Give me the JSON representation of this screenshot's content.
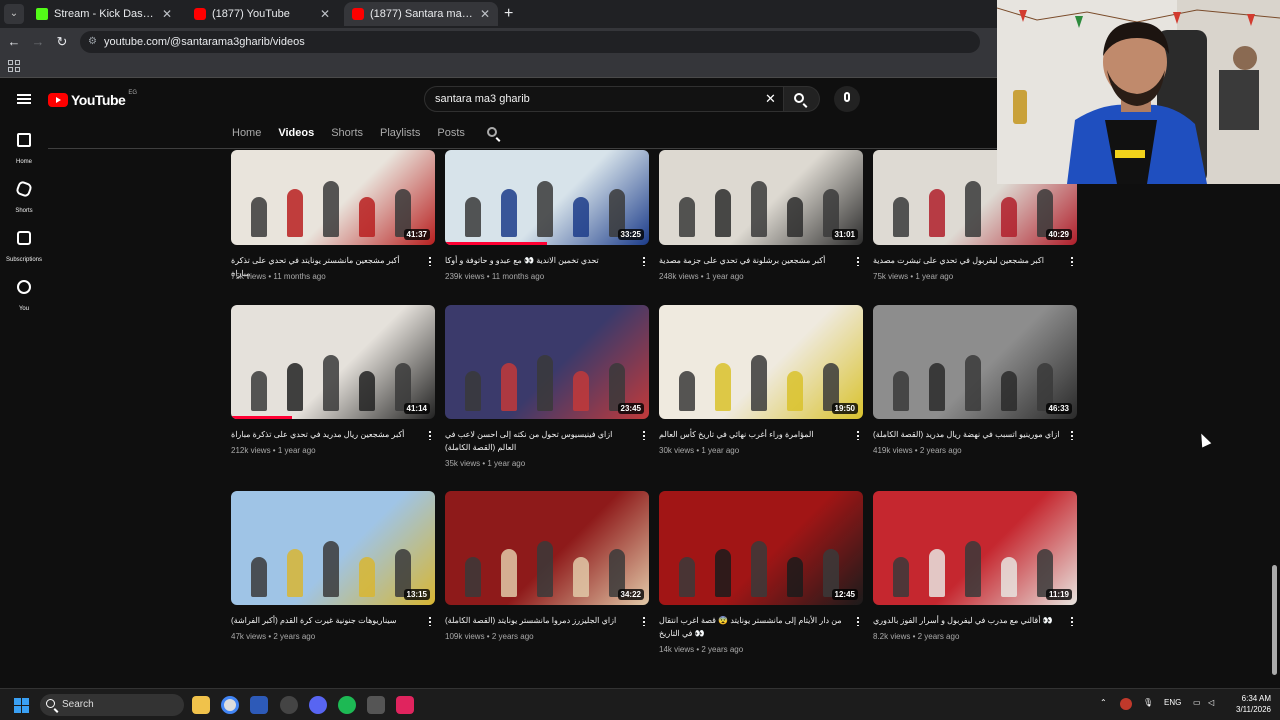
{
  "browser": {
    "tabs": [
      {
        "title": "Stream - Kick Dashboard",
        "favicon": "kick-icon"
      },
      {
        "title": "(1877) YouTube",
        "favicon": "youtube-icon"
      },
      {
        "title": "(1877) Santara ma3 Gharib - Yo",
        "favicon": "youtube-icon"
      }
    ],
    "url": "youtube.com/@santarama3gharib/videos"
  },
  "youtube": {
    "logo_text": "YouTube",
    "country_code": "EG",
    "search_value": "santara ma3 gharib",
    "sidenav": [
      {
        "label": "Home",
        "icon": "home-icon"
      },
      {
        "label": "Shorts",
        "icon": "shorts-icon"
      },
      {
        "label": "Subscriptions",
        "icon": "subscriptions-icon"
      },
      {
        "label": "You",
        "icon": "you-icon"
      }
    ],
    "channel_tabs": [
      "Home",
      "Videos",
      "Shorts",
      "Playlists",
      "Posts"
    ],
    "active_tab": "Videos"
  },
  "videos": [
    {
      "title": "أكبر مشجعين مانشستر يونايتد في تحدي على تذكرة مباراة",
      "views": "75k views",
      "age": "11 months ago",
      "duration": "41:37",
      "watched": 0,
      "colors": [
        "#e9e4dc",
        "#b82020"
      ]
    },
    {
      "title": "تحدي تخمين الاندية 👀 مع عبدو و حاتوفة و أوكا",
      "views": "239k views",
      "age": "11 months ago",
      "duration": "33:25",
      "watched": 0.5,
      "colors": [
        "#d7e3ea",
        "#1c3c8a"
      ]
    },
    {
      "title": "أكبر مشجعين برشلونة في تحدي على جزمة مصدية",
      "views": "248k views",
      "age": "1 year ago",
      "duration": "31:01",
      "watched": 0,
      "colors": [
        "#ddd9d1",
        "#2d2d2d"
      ]
    },
    {
      "title": "اكبر مشجعين ليفربول في تحدي على تيشرت مصدية",
      "views": "75k views",
      "age": "1 year ago",
      "duration": "40:29",
      "watched": 0,
      "colors": [
        "#dedad3",
        "#b01e2a"
      ]
    },
    {
      "title": "أكبر مشجعين ريال مدريد في تحدي على تذكرة مباراة",
      "views": "212k views",
      "age": "1 year ago",
      "duration": "41:14",
      "watched": 0.3,
      "colors": [
        "#e5e1db",
        "#222222"
      ]
    },
    {
      "title": "ازاي فينيسيوس تحول من نكته إلى احسن لاعب في العالم (القصة الكاملة)",
      "views": "35k views",
      "age": "1 year ago",
      "duration": "23:45",
      "watched": 0,
      "colors": [
        "#3b3a6b",
        "#c23a3a"
      ]
    },
    {
      "title": "المؤامرة وراء أغرب نهائي في تاريخ كأس العالم",
      "views": "30k views",
      "age": "1 year ago",
      "duration": "19:50",
      "watched": 0,
      "colors": [
        "#efeadf",
        "#d9c22c"
      ]
    },
    {
      "title": "ازاي مورينيو اتسبب في نهضة ريال مدريد (القصة الكاملة)",
      "views": "419k views",
      "age": "2 years ago",
      "duration": "46:33",
      "watched": 0,
      "colors": [
        "#8d8d8d",
        "#2a2a2a"
      ]
    },
    {
      "title": "سيناريوهات جنونية غيرت كرة القدم (أكبر الفراشة)",
      "views": "47k views",
      "age": "2 years ago",
      "duration": "13:15",
      "watched": 0,
      "colors": [
        "#9fc4e6",
        "#d8b632"
      ]
    },
    {
      "title": "ازاي الجليزرز دمروا مانشستر يونايتد (القصة الكاملة)",
      "views": "109k views",
      "age": "2 years ago",
      "duration": "34:22",
      "watched": 0,
      "colors": [
        "#8e1a1a",
        "#e2c9a8"
      ]
    },
    {
      "title": "من دار الأيتام إلى مانشستر يونايتد 😨 قصة اغرب انتقال في التاريخ 👀",
      "views": "14k views",
      "age": "2 years ago",
      "duration": "12:45",
      "watched": 0,
      "colors": [
        "#a11515",
        "#1b1b1b"
      ]
    },
    {
      "title": "أقالني مع مدرب في ليفربول و أسرار الفوز بالدوري 👀",
      "views": "8.2k views",
      "age": "2 years ago",
      "duration": "11:19",
      "watched": 0,
      "colors": [
        "#c5272f",
        "#e8e4df"
      ]
    }
  ],
  "taskbar": {
    "search_label": "Search",
    "language": "ENG",
    "time": "6:34 AM",
    "date": "3/11/2026"
  }
}
